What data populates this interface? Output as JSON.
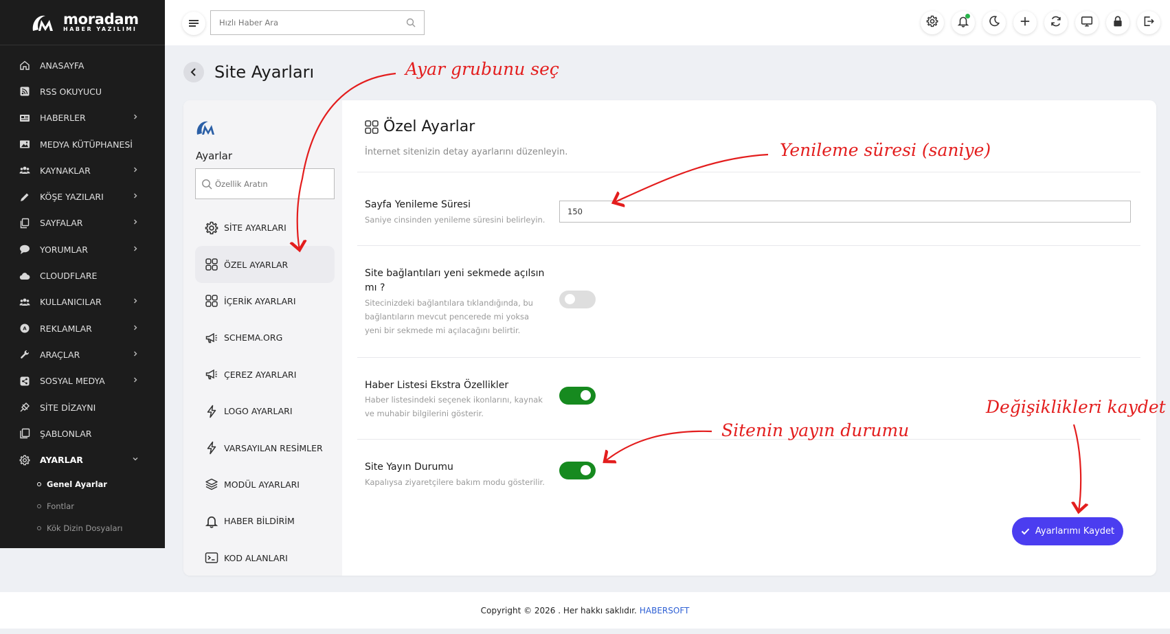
{
  "app": {
    "brand_name": "moradam",
    "brand_tagline": "HABER YAZILIMI"
  },
  "sidebar": {
    "items": [
      {
        "label": "ANASAYFA",
        "icon": "home-icon",
        "chevron": false
      },
      {
        "label": "RSS OKUYUCU",
        "icon": "rss-icon",
        "chevron": false
      },
      {
        "label": "HABERLER",
        "icon": "newspaper-icon",
        "chevron": true
      },
      {
        "label": "MEDYA KÜTÜPHANESİ",
        "icon": "image-icon",
        "chevron": false
      },
      {
        "label": "KAYNAKLAR",
        "icon": "users-group-icon",
        "chevron": true
      },
      {
        "label": "KÖŞE YAZILARI",
        "icon": "pen-icon",
        "chevron": true
      },
      {
        "label": "SAYFALAR",
        "icon": "pages-icon",
        "chevron": true
      },
      {
        "label": "YORUMLAR",
        "icon": "comment-icon",
        "chevron": true
      },
      {
        "label": "CLOUDFLARE",
        "icon": "cloud-icon",
        "chevron": false
      },
      {
        "label": "KULLANICILAR",
        "icon": "users-icon",
        "chevron": true
      },
      {
        "label": "REKLAMLAR",
        "icon": "ads-icon",
        "chevron": true
      },
      {
        "label": "ARAÇLAR",
        "icon": "wrench-icon",
        "chevron": true
      },
      {
        "label": "SOSYAL MEDYA",
        "icon": "share-icon",
        "chevron": true
      },
      {
        "label": "SİTE DİZAYNI",
        "icon": "design-icon",
        "chevron": false
      },
      {
        "label": "ŞABLONLAR",
        "icon": "templates-icon",
        "chevron": false
      },
      {
        "label": "AYARLAR",
        "icon": "gear-icon",
        "chevron": true,
        "expanded": true
      }
    ],
    "subitems": [
      {
        "label": "Genel Ayarlar",
        "active": true
      },
      {
        "label": "Fontlar",
        "active": false
      },
      {
        "label": "Kök Dizin Dosyaları",
        "active": false
      }
    ]
  },
  "topbar": {
    "search_placeholder": "Hızlı Haber Ara",
    "icons": [
      "gear-icon",
      "bell-icon",
      "moon-icon",
      "plus-icon",
      "refresh-icon",
      "monitor-icon",
      "lock-icon",
      "logout-icon"
    ]
  },
  "page": {
    "title": "Site Ayarları"
  },
  "settings_nav": {
    "title": "Ayarlar",
    "search_placeholder": "Özellik Aratın",
    "items": [
      {
        "label": "SİTE AYARLARI",
        "icon": "gear-icon"
      },
      {
        "label": "ÖZEL AYARLAR",
        "icon": "grid-icon",
        "active": true
      },
      {
        "label": "İÇERİK AYARLARI",
        "icon": "grid-icon"
      },
      {
        "label": "SCHEMA.ORG",
        "icon": "megaphone-icon"
      },
      {
        "label": "ÇEREZ AYARLARI",
        "icon": "megaphone-icon"
      },
      {
        "label": "LOGO AYARLARI",
        "icon": "bolt-icon"
      },
      {
        "label": "VARSAYILAN RESİMLER",
        "icon": "bolt-icon"
      },
      {
        "label": "MODÜL AYARLARI",
        "icon": "layers-icon"
      },
      {
        "label": "HABER BİLDİRİM",
        "icon": "bell-icon"
      },
      {
        "label": "KOD ALANLARI",
        "icon": "terminal-icon"
      }
    ]
  },
  "content": {
    "section_title": "Özel Ayarlar",
    "section_subtitle": "İnternet sitenizin detay ayarlarını düzenleyin.",
    "settings": [
      {
        "title": "Sayfa Yenileme Süresi",
        "description": "Saniye cinsinden yenileme süresini belirleyin.",
        "type": "number",
        "value": "150"
      },
      {
        "title": "Site bağlantıları yeni sekmede açılsın mı ?",
        "description": "Sitecinizdeki bağlantılara tıklandığında, bu bağlantıların mevcut pencerede mi yoksa yeni bir sekmede mi açılacağını belirtir.",
        "type": "toggle",
        "value": false
      },
      {
        "title": "Haber Listesi Ekstra Özellikler",
        "description": "Haber listesindeki seçenek ikonlarını, kaynak ve muhabir bilgilerini gösterir.",
        "type": "toggle",
        "value": true
      },
      {
        "title": "Site Yayın Durumu",
        "description": "Kapalıysa ziyaretçilere bakım modu gösterilir.",
        "type": "toggle",
        "value": true
      }
    ],
    "save_label": "Ayarlarımı Kaydet"
  },
  "footer": {
    "text": "Copyright © 2026 . Her hakkı saklıdır.",
    "link": "HABERSOFT"
  },
  "annotations": {
    "a1": "Ayar grubunu seç",
    "a2": "Yenileme süresi (saniye)",
    "a3": "Sitenin yayın durumu",
    "a4": "Değişiklikleri kaydet"
  },
  "colors": {
    "sidebar_bg": "#1c1c1c",
    "accent": "#4b3df0",
    "toggle_on": "#168a1f",
    "annotation": "#e31d1d",
    "link": "#2d5fd4"
  }
}
